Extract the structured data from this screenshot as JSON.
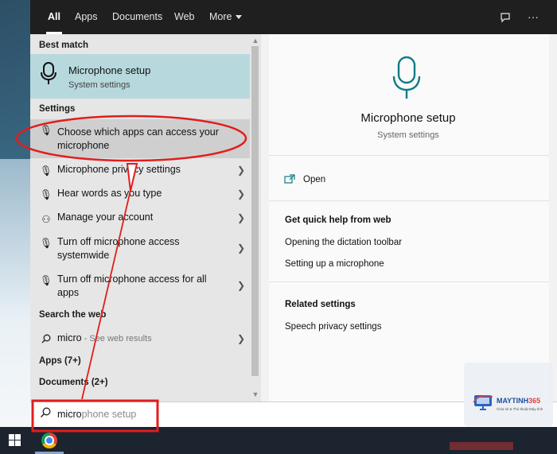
{
  "tabs": [
    {
      "label": "All",
      "active": true
    },
    {
      "label": "Apps"
    },
    {
      "label": "Documents"
    },
    {
      "label": "Web"
    },
    {
      "label": "More"
    }
  ],
  "top_icons": [
    "feedback-icon",
    "more-options-icon"
  ],
  "best_match": {
    "header": "Best match",
    "title": "Microphone setup",
    "subtitle": "System settings"
  },
  "settings": {
    "header": "Settings",
    "items": [
      {
        "label": "Choose which apps can access your microphone",
        "icon": "microphone-icon",
        "selected": true
      },
      {
        "label": "Microphone privacy settings",
        "icon": "microphone-icon"
      },
      {
        "label": "Hear words as you type",
        "icon": "microphone-icon"
      },
      {
        "label": "Manage your account",
        "icon": "account-icon"
      },
      {
        "label": "Turn off microphone access systemwide",
        "icon": "microphone-icon"
      },
      {
        "label": "Turn off microphone access for all apps",
        "icon": "microphone-icon"
      }
    ]
  },
  "search_web": {
    "header": "Search the web",
    "query": "micro",
    "suffix": " - See web results"
  },
  "apps_header": "Apps (7+)",
  "documents_header": "Documents (2+)",
  "preview": {
    "title": "Microphone setup",
    "subtitle": "System settings",
    "open_label": "Open",
    "quick_help_header": "Get quick help from web",
    "quick_help_links": [
      "Opening the dictation toolbar",
      "Setting up a microphone"
    ],
    "related_header": "Related settings",
    "related_links": [
      "Speech privacy settings"
    ]
  },
  "search": {
    "typed": "micro",
    "hint": "phone setup"
  },
  "watermark": {
    "brand_main": "MAYTINH",
    "brand_accent": "365",
    "tagline": "Chia sẻ & Thủ thuật Máy tính"
  },
  "colors": {
    "accent_teal": "#0e7c86",
    "best_match_bg": "#b7d9de",
    "annotation_red": "#e11d1d"
  }
}
